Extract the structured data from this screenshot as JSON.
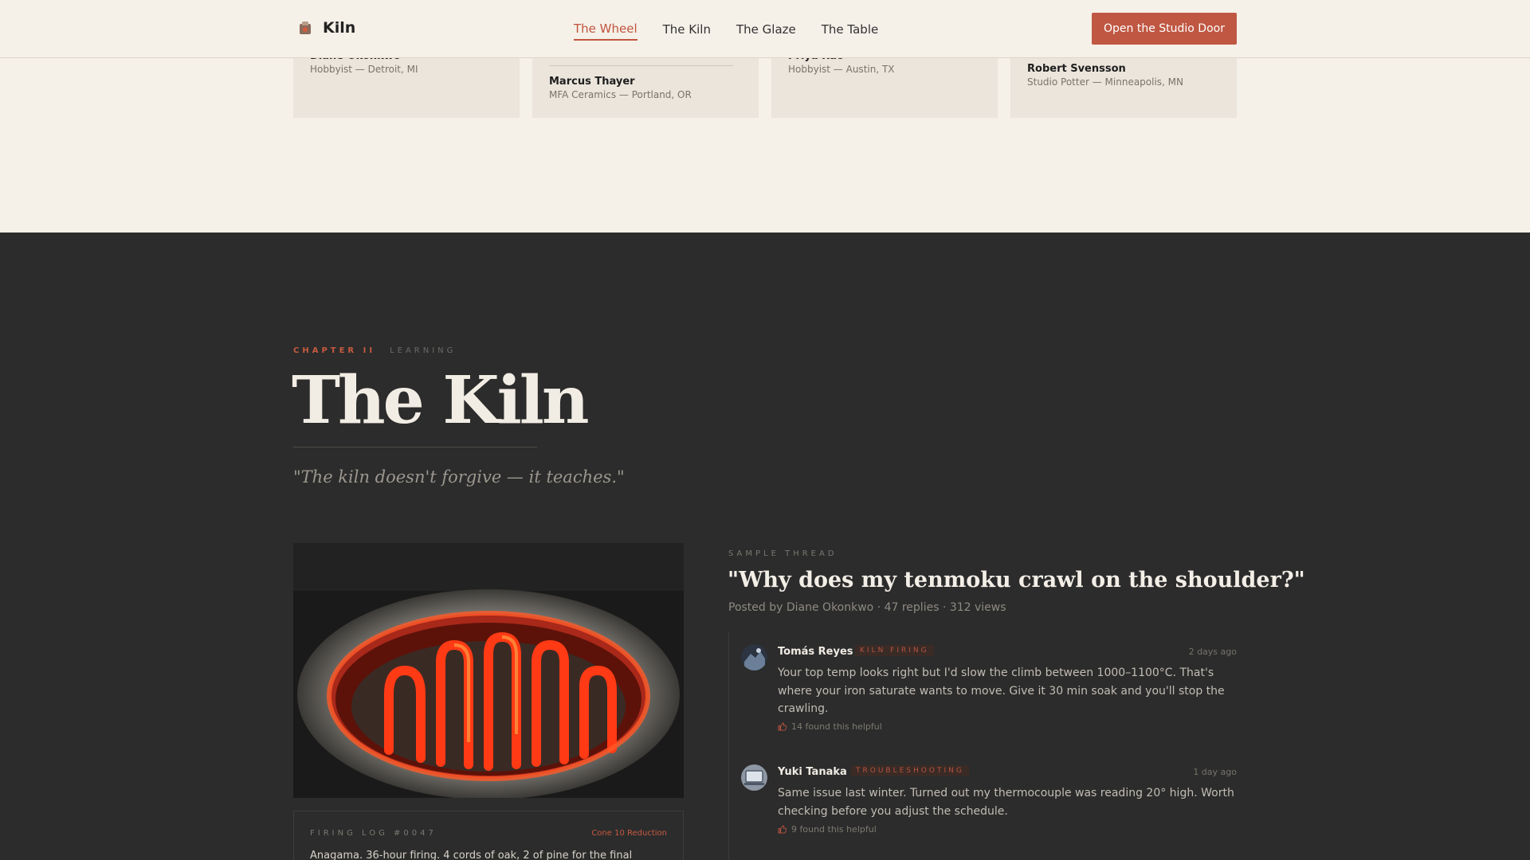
{
  "header": {
    "brand": "Kiln",
    "nav": [
      "The Wheel",
      "The Kiln",
      "The Glaze",
      "The Table"
    ],
    "active_nav": "The Wheel",
    "cta": "Open the Studio Door"
  },
  "testimonials": [
    {
      "name": "Diane Okonkwo",
      "role": "Hobbyist — Detroit, MI"
    },
    {
      "name": "Marcus Thayer",
      "role": "MFA Ceramics — Portland, OR"
    },
    {
      "name": "Priya Rao",
      "role": "Hobbyist — Austin, TX"
    },
    {
      "name": "Robert Svensson",
      "role": "Studio Potter — Minneapolis, MN"
    }
  ],
  "chapter": {
    "label": "CHAPTER II",
    "sub": "LEARNING",
    "title": "The Kiln",
    "quote": "\"The kiln doesn't forgive — it teaches.\""
  },
  "firing_log": {
    "label": "FIRING LOG #0047",
    "tag": "Cone 10 Reduction",
    "text": "Anagama. 36-hour firing. 4 cords of oak, 2 of pine for the final"
  },
  "thread": {
    "eyebrow": "SAMPLE THREAD",
    "title": "\"Why does my tenmoku crawl on the shoulder?\"",
    "meta": "Posted by Diane Okonkwo · 47 replies · 312 views",
    "replies": [
      {
        "name": "Tomás Reyes",
        "tag": "KILN FIRING",
        "time": "2 days ago",
        "body": "Your top temp looks right but I'd slow the climb between 1000–1100°C. That's where your iron saturate wants to move. Give it 30 min soak and you'll stop the crawling.",
        "helpful": "14 found this helpful",
        "icon": "thumbs-up-icon"
      },
      {
        "name": "Yuki Tanaka",
        "tag": "TROUBLESHOOTING",
        "time": "1 day ago",
        "body": "Same issue last winter. Turned out my thermocouple was reading 20° high. Worth checking before you adjust the schedule.",
        "helpful": "9 found this helpful",
        "icon": "thumbs-up-icon"
      }
    ]
  },
  "colors": {
    "accent": "#bf5742",
    "light_bg": "#f5f0e8",
    "dark_bg": "#2c2c2c"
  }
}
